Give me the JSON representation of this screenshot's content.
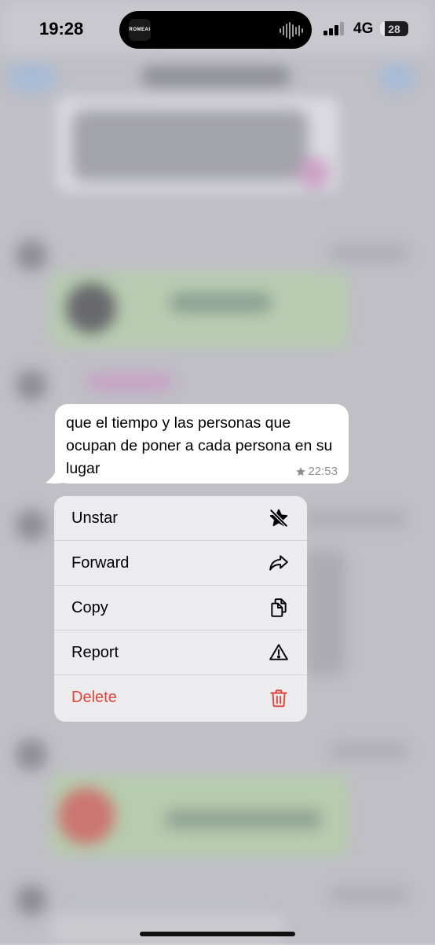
{
  "status_bar": {
    "time": "19:28",
    "island_app": "ROMEAI",
    "network": "4G",
    "battery": "28"
  },
  "message": {
    "text": "que el tiempo y las personas que ocupan de poner a cada persona en su lugar",
    "time": "22:53",
    "starred_icon": "star-icon"
  },
  "context_menu": {
    "items": [
      {
        "label": "Unstar",
        "icon": "unstar-icon"
      },
      {
        "label": "Forward",
        "icon": "forward-icon"
      },
      {
        "label": "Copy",
        "icon": "copy-icon"
      },
      {
        "label": "Report",
        "icon": "report-icon"
      },
      {
        "label": "Delete",
        "icon": "trash-icon"
      }
    ]
  },
  "colors": {
    "delete": "#e0443b",
    "bubble": "#ffffff",
    "menu": "#ececee"
  }
}
